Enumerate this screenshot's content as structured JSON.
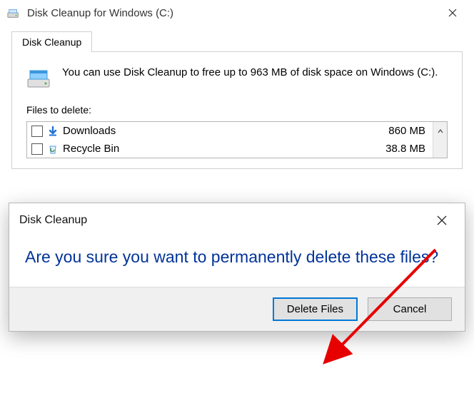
{
  "window": {
    "title": "Disk Cleanup for Windows (C:)"
  },
  "tab": {
    "label": "Disk Cleanup"
  },
  "intro": {
    "text": "You can use Disk Cleanup to free up to 963 MB of disk space on Windows (C:)."
  },
  "list": {
    "label": "Files to delete:",
    "items": [
      {
        "name": "Downloads",
        "size": "860 MB",
        "icon": "download-arrow-icon"
      },
      {
        "name": "Recycle Bin",
        "size": "38.8 MB",
        "icon": "recycle-bin-icon"
      }
    ]
  },
  "dialog": {
    "title": "Disk Cleanup",
    "message": "Are you sure you want to permanently delete these files?",
    "primary_label": "Delete Files",
    "cancel_label": "Cancel"
  }
}
